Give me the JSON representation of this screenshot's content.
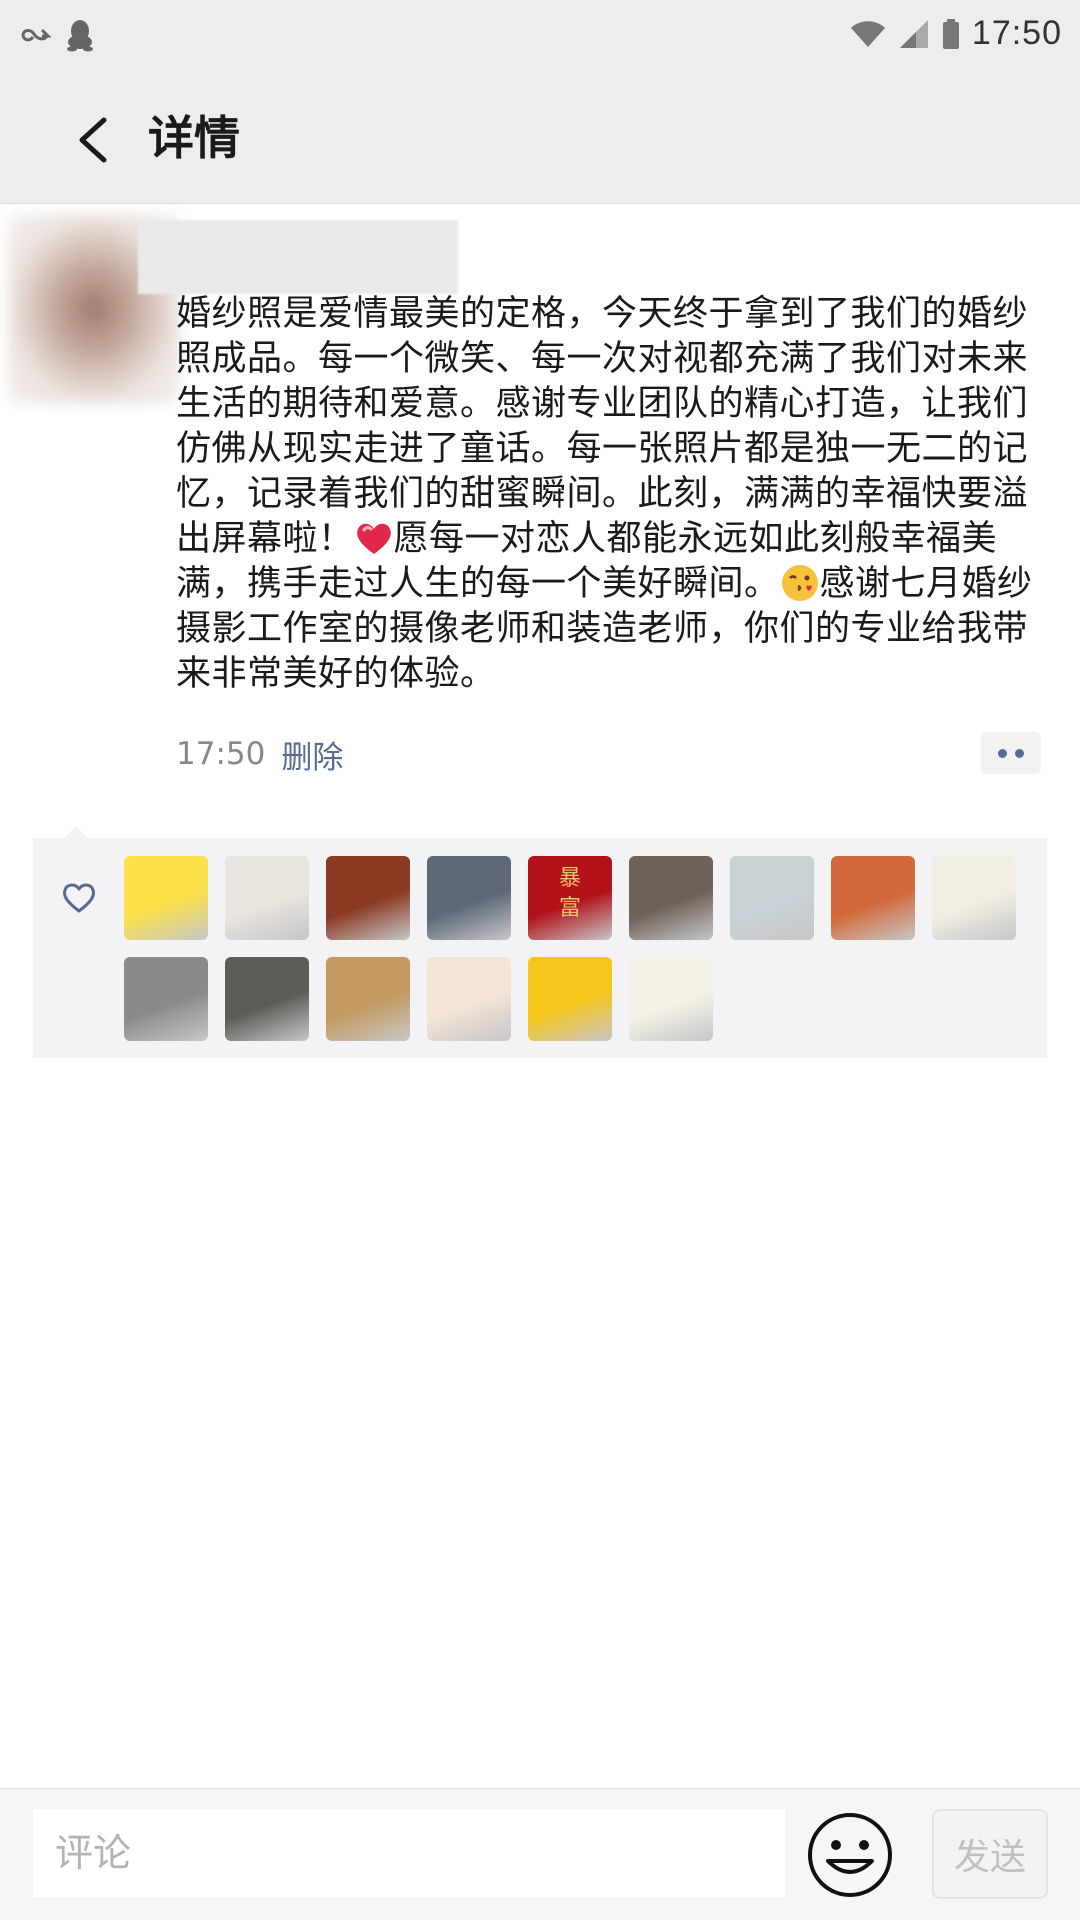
{
  "status_bar": {
    "time": "17:50",
    "left_icons": [
      "link-icon",
      "qq-icon"
    ],
    "right_icons": [
      "wifi-icon",
      "cellular-signal-icon",
      "battery-icon"
    ]
  },
  "header": {
    "back_icon": "chevron-left-icon",
    "title": "详情"
  },
  "post": {
    "text_parts": [
      "婚纱照是爱情最美的定格，今天终于拿到了我们的婚纱照成品。每一个微笑、每一次对视都充满了我们对未来生活的期待和爱意。感谢专业团队的精心打造，让我们仿佛从现实走进了童话。每一张照片都是独一无二的记忆，记录着我们的甜蜜瞬间。此刻，满满的幸福快要溢出屏幕啦！",
      "愿每一对恋人都能永远如此刻般幸福美满，携手走过人生的每一个美好瞬间。",
      "感谢七月婚纱摄影工作室的摄像老师和装造老师，你们的专业给我带来非常美好的体验。"
    ],
    "inline_emojis": [
      "heart-emoji",
      "kiss-face-emoji"
    ],
    "time": "17:50",
    "delete_label": "删除"
  },
  "likes": {
    "icon": "heart-outline-icon",
    "count": 15,
    "avatars": [
      {
        "desc": "pikachu-avatar",
        "color": "#fbe14a"
      },
      {
        "desc": "white-dog-avatar",
        "color": "#e9e4dd"
      },
      {
        "desc": "muscle-man-avatar",
        "color": "#8a3a22"
      },
      {
        "desc": "outdoor-court-avatar",
        "color": "#5d6878"
      },
      {
        "desc": "red-text-avatar",
        "color": "#b3121a",
        "text": "暴富"
      },
      {
        "desc": "sitting-man-avatar",
        "color": "#6e6259"
      },
      {
        "desc": "anime-girl-teal-avatar",
        "color": "#c9d3d6"
      },
      {
        "desc": "anime-girl-orange-avatar",
        "color": "#d3693a"
      },
      {
        "desc": "sketch-bunny-avatar",
        "color": "#f2ede3"
      },
      {
        "desc": "otter-avatar",
        "color": "#8a8a8a"
      },
      {
        "desc": "old-photo-man-avatar",
        "color": "#5c5c57"
      },
      {
        "desc": "cat-avatar",
        "color": "#c49a60"
      },
      {
        "desc": "chibi-girl-avatar",
        "color": "#f3e4d6"
      },
      {
        "desc": "delivery-helmet-avatar",
        "color": "#f5c51c"
      },
      {
        "desc": "penguin-avatar",
        "color": "#f4f1e6"
      }
    ]
  },
  "comment_bar": {
    "placeholder": "评论",
    "emoji_icon": "smiley-face-icon",
    "send_label": "发送"
  },
  "colors": {
    "header_bg": "#ededed",
    "link_blue": "#576b95",
    "likes_bg": "#f3f3f5"
  }
}
